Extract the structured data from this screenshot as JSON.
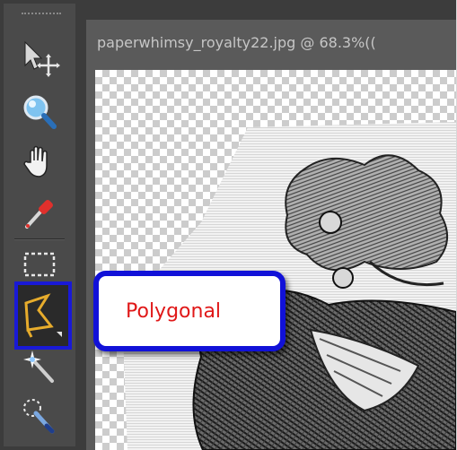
{
  "document": {
    "title": "paperwhimsy_royalty22.jpg @ 68.3%(("
  },
  "toolbar": {
    "tools": [
      {
        "name": "move-tool",
        "icon": "move-icon"
      },
      {
        "name": "zoom-tool",
        "icon": "magnifier-icon"
      },
      {
        "name": "hand-tool",
        "icon": "hand-icon"
      },
      {
        "name": "eyedropper-tool",
        "icon": "eyedropper-icon"
      },
      {
        "name": "rectangular-marquee-tool",
        "icon": "marquee-icon"
      },
      {
        "name": "polygonal-lasso-tool",
        "icon": "polygonal-lasso-icon",
        "selected": true
      },
      {
        "name": "magic-wand-tool",
        "icon": "magic-wand-icon"
      },
      {
        "name": "quick-selection-tool",
        "icon": "quick-selection-icon"
      }
    ]
  },
  "callout": {
    "label": "Polygonal"
  },
  "colors": {
    "highlight_border": "#1919d6",
    "callout_text": "#e01818",
    "toolbar_bg": "#4a4a4a",
    "window_bg": "#5a5a5a"
  }
}
